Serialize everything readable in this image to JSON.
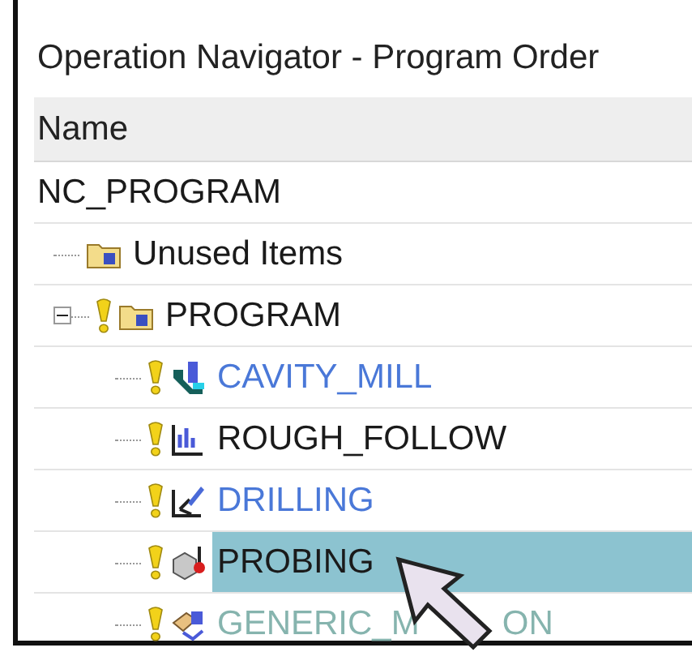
{
  "window": {
    "title": "Operation Navigator - Program Order"
  },
  "table": {
    "columns": [
      "Name"
    ]
  },
  "tree": {
    "label": "NC_PROGRAM",
    "children": [
      {
        "label": "Unused Items",
        "kind": "folder",
        "selected": false,
        "color": "#1a1a1a"
      },
      {
        "label": "PROGRAM",
        "kind": "folder",
        "warning": true,
        "expanded": true,
        "selected": false,
        "color": "#1a1a1a",
        "children": [
          {
            "label": "CAVITY_MILL",
            "kind": "cavity",
            "warning": true,
            "selected": false,
            "color": "#4a78d8"
          },
          {
            "label": "ROUGH_FOLLOW",
            "kind": "follow",
            "warning": true,
            "selected": false,
            "color": "#1a1a1a"
          },
          {
            "label": "DRILLING",
            "kind": "drill",
            "warning": true,
            "selected": false,
            "color": "#4a78d8"
          },
          {
            "label": "PROBING",
            "kind": "probe",
            "warning": true,
            "selected": true,
            "color": "#1a1a1a"
          },
          {
            "label": "GENERIC_M",
            "label_after_pointer": "ON",
            "kind": "generic",
            "warning": true,
            "selected": false,
            "color": "#86b4ae"
          }
        ]
      }
    ]
  }
}
